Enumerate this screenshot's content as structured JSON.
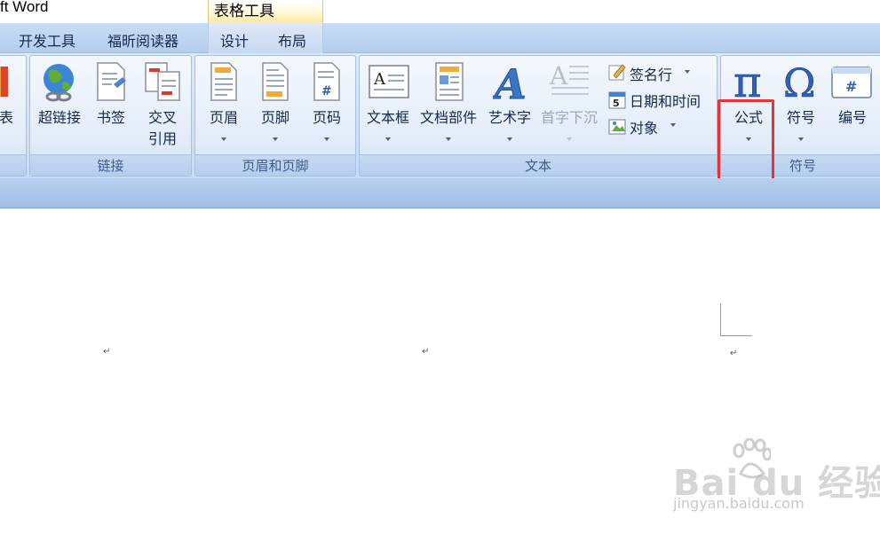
{
  "window": {
    "title": "ft Word",
    "context_tab_header": "表格工具"
  },
  "tabs": [
    {
      "label": "开发工具"
    },
    {
      "label": "福昕阅读器"
    },
    {
      "label": "设计"
    },
    {
      "label": "布局"
    }
  ],
  "ribbon": {
    "partial_group": {
      "button_label": "表"
    },
    "links_group": {
      "label": "链接",
      "hyperlink": "超链接",
      "bookmark": "书签",
      "cross_ref_line1": "交叉",
      "cross_ref_line2": "引用"
    },
    "header_footer_group": {
      "label": "页眉和页脚",
      "header": "页眉",
      "footer": "页脚",
      "page_number": "页码"
    },
    "text_group": {
      "label": "文本",
      "textbox": "文本框",
      "quick_parts": "文档部件",
      "wordart": "艺术字",
      "drop_cap": "首字下沉",
      "signature_line": "签名行",
      "date_time": "日期和时间",
      "object": "对象"
    },
    "symbols_group": {
      "label": "符号",
      "equation": "公式",
      "symbol": "符号",
      "number": "编号"
    }
  },
  "document": {
    "paragraph_marks": [
      "↵",
      "↵",
      "↵"
    ]
  },
  "watermark": {
    "logo": "Bai  du 经验",
    "url": "jingyan.baidu.com"
  },
  "colors": {
    "highlight": "#e0343a",
    "ribbon_blue": "#c9dbf3",
    "text": "#15284b"
  }
}
